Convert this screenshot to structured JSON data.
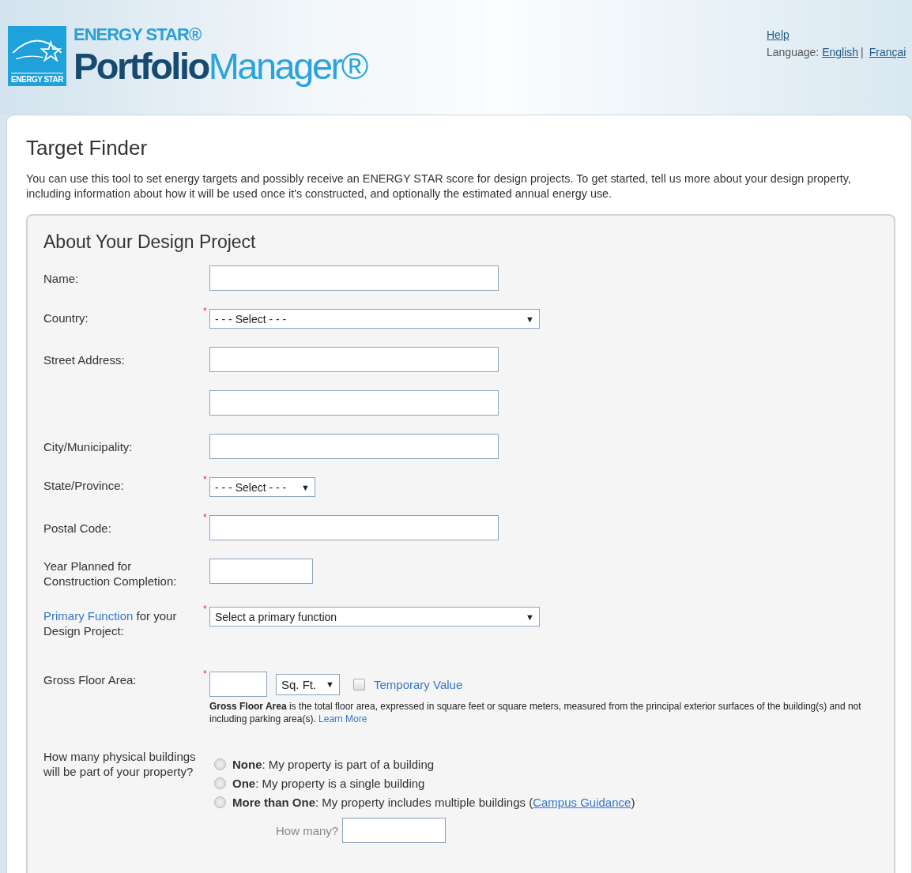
{
  "header": {
    "badge_text": "ENERGY STAR",
    "brand": "ENERGY STAR®",
    "product_bold": "Portfolio",
    "product_light": "Manager®",
    "help_link": "Help",
    "language_label": "Language:",
    "languages": [
      {
        "label": "English"
      },
      {
        "label": "Françai"
      }
    ],
    "language_separator": "|"
  },
  "page": {
    "title": "Target Finder",
    "intro": "You can use this tool to set energy targets and possibly receive an ENERGY STAR score for design projects. To get started, tell us more about your design property, including information about how it will be used once it's constructed, and optionally the estimated annual energy use."
  },
  "form": {
    "title": "About Your Design Project",
    "required_mark": "*",
    "select_arrow": "▼",
    "fields": [
      {
        "kind": "text",
        "label": "Name:",
        "required": false
      },
      {
        "kind": "select",
        "label": "Country:",
        "required": true,
        "value": "- - - Select - - -"
      },
      {
        "kind": "address",
        "label": "Street Address:",
        "required": false
      },
      {
        "kind": "text",
        "label": "City/Municipality:",
        "required": false
      },
      {
        "kind": "select-short",
        "label": "State/Province:",
        "required": true,
        "value": "- - - Select - - -"
      },
      {
        "kind": "text",
        "label": "Postal Code:",
        "required": true
      },
      {
        "kind": "text-short",
        "label": "Year Planned for Construction Completion:",
        "required": false
      },
      {
        "kind": "select",
        "label_link": "Primary Function",
        "label": " for your Design Project:",
        "required": true,
        "value": "Select a primary function"
      },
      {
        "kind": "area",
        "label": "Gross Floor Area:",
        "required": true,
        "unit": "Sq. Ft.",
        "checkbox": {
          "label": "Temporary Value",
          "checked": false
        },
        "hint": "**Gross Floor Area** is the total floor area, expressed in square feet or square meters, measured from the principal exterior surfaces of the building(s) and not including parking area(s).",
        "hint_link": "Learn More"
      },
      {
        "kind": "radio",
        "label": "How many physical buildings will be part of your property?",
        "required": false,
        "options": [
          {
            "text": "**None**: My property is part of a building",
            "selected": false
          },
          {
            "text": "**One**: My property is a single building",
            "selected": false
          },
          {
            "text": "**More than One**: My property includes multiple buildings (",
            "link": "Campus Guidance",
            "after": ")",
            "selected": false
          }
        ],
        "count_label": "How many?"
      }
    ]
  }
}
